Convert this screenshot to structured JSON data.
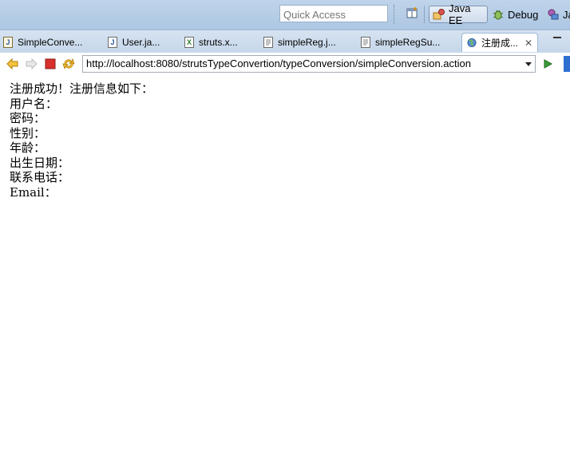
{
  "toolbar": {
    "quick_access_placeholder": "Quick Access",
    "perspectives": [
      {
        "label": "Java EE",
        "active": true
      },
      {
        "label": "Debug",
        "active": false
      },
      {
        "label": "Ja",
        "active": false
      }
    ]
  },
  "tabs": [
    {
      "label": "SimpleConve...",
      "icon": "java-file-icon"
    },
    {
      "label": "User.ja...",
      "icon": "java-file-icon"
    },
    {
      "label": "struts.x...",
      "icon": "xml-file-icon"
    },
    {
      "label": "simpleReg.j...",
      "icon": "jsp-file-icon"
    },
    {
      "label": "simpleRegSu...",
      "icon": "jsp-file-icon"
    },
    {
      "label": "注册成...",
      "icon": "globe-icon",
      "active": true
    }
  ],
  "browser": {
    "url": "http://localhost:8080/strutsTypeConvertion/typeConversion/simpleConversion.action"
  },
  "page": {
    "heading": "注册成功！注册信息如下：",
    "fields": [
      "用户名：",
      "密码：",
      "性别：",
      "年龄：",
      "出生日期：",
      "联系电话：",
      "Email："
    ]
  }
}
